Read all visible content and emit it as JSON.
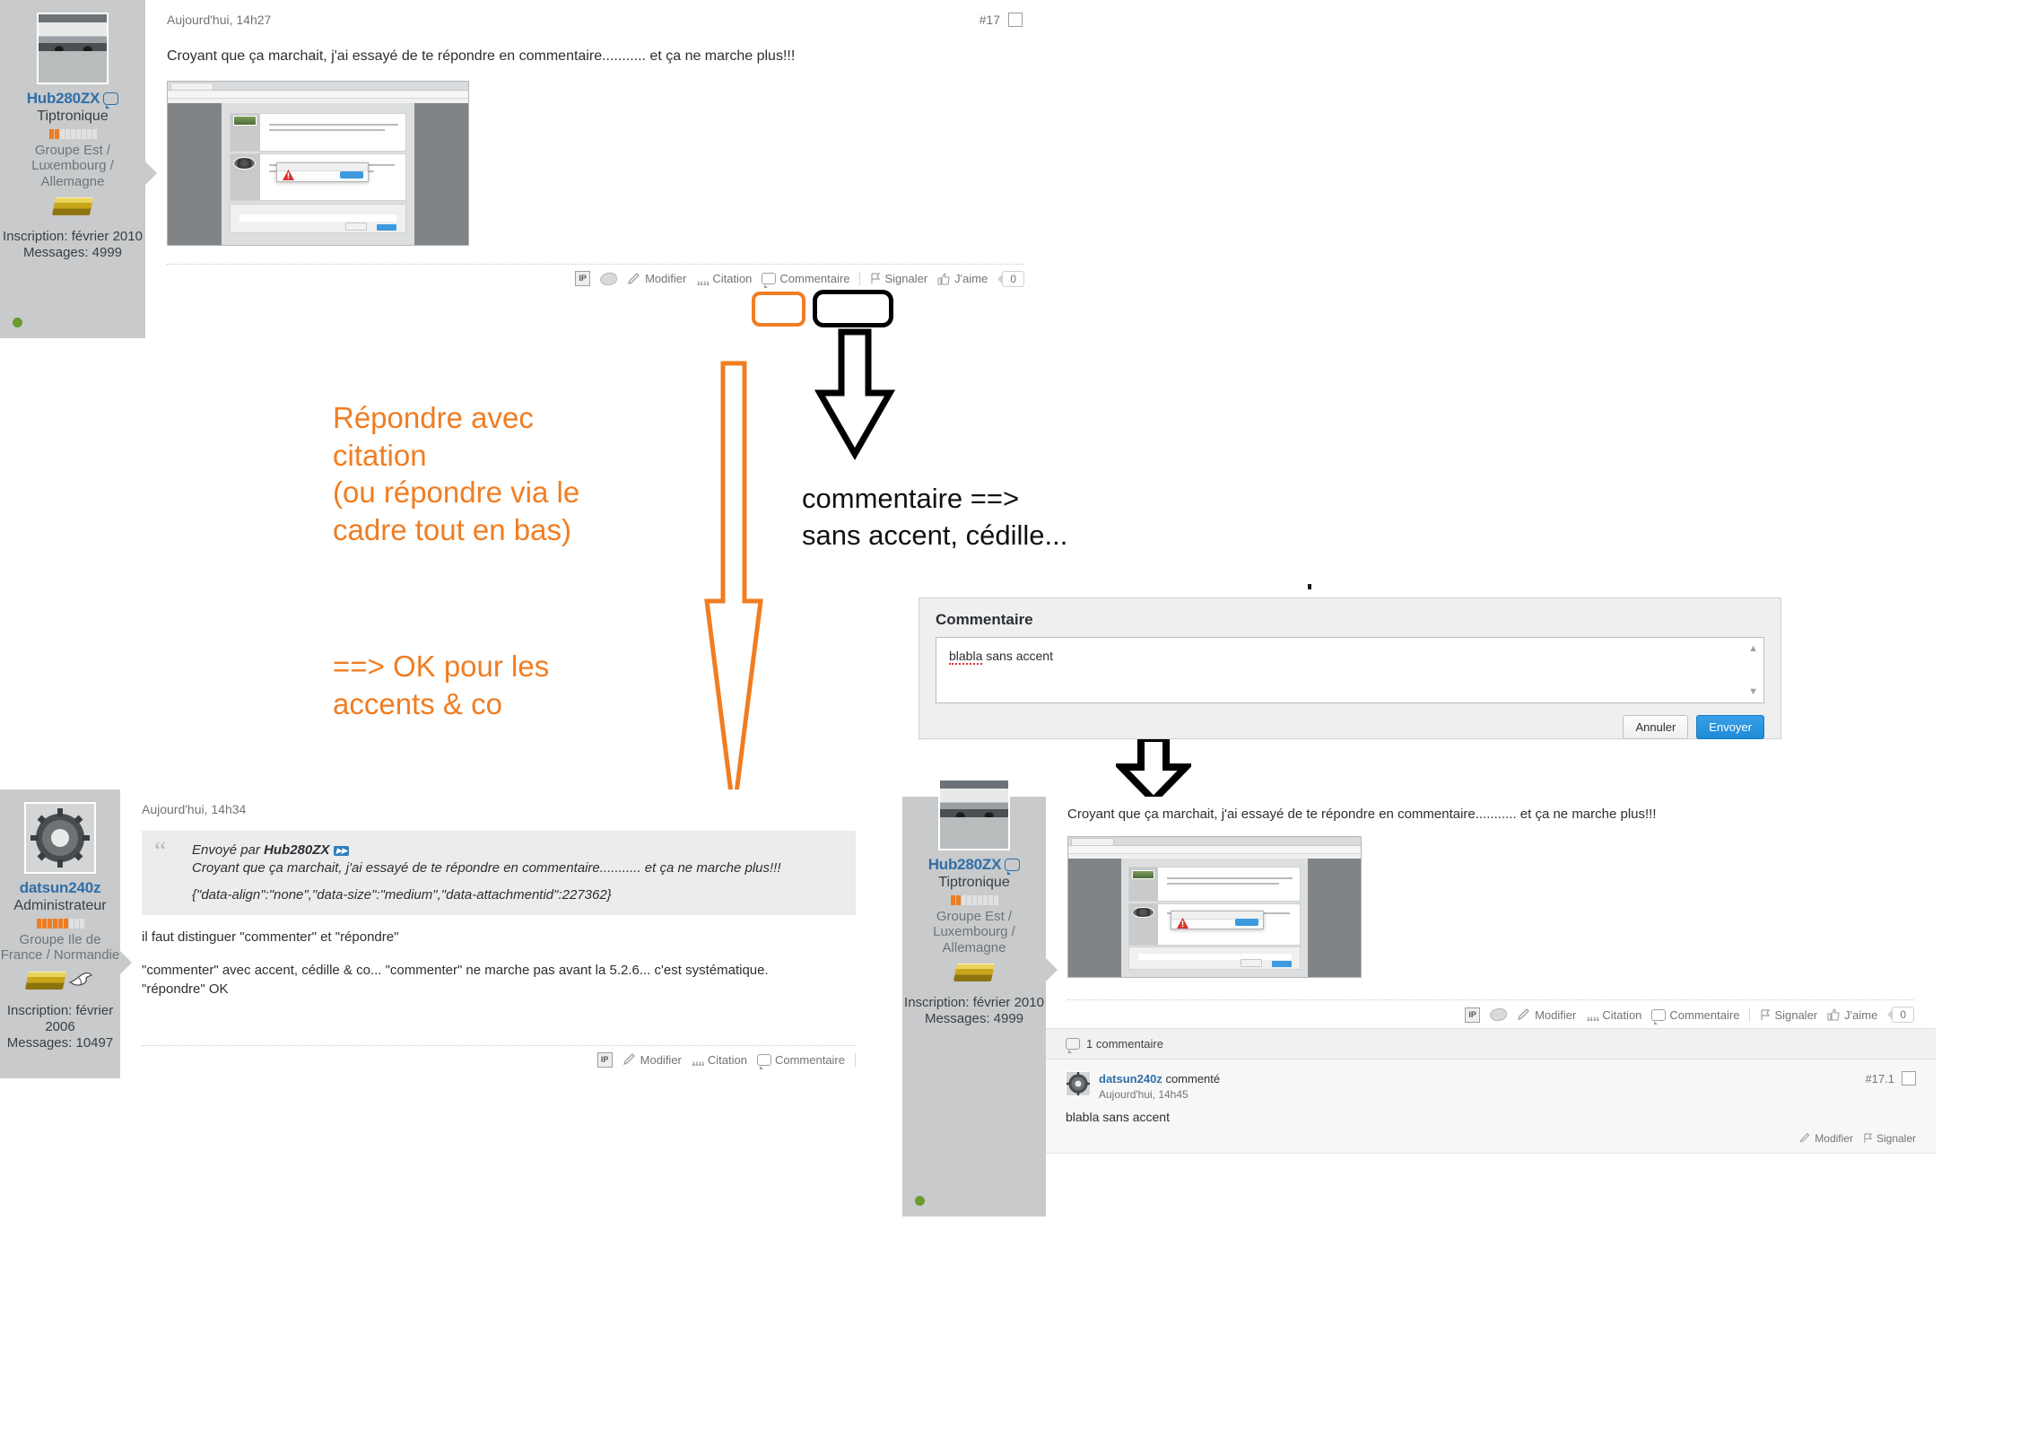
{
  "post_top": {
    "user": {
      "name": "Hub280ZX",
      "title": "Tiptronique",
      "group": "Groupe Est / Luxembourg / Allemagne",
      "inscription": "Inscription: février 2010",
      "messages": "Messages: 4999",
      "rank_filled": 2,
      "rank_total": 10
    },
    "time": "Aujourd'hui, 14h27",
    "number": "#17",
    "text": "Croyant que ça marchait, j'ai essayé de te répondre en commentaire........... et ça ne marche plus!!!",
    "footer": {
      "ip": "IP",
      "modifier": "Modifier",
      "citation": "Citation",
      "commentaire": "Commentaire",
      "signaler": "Signaler",
      "jaime": "J'aime",
      "like_count": "0"
    }
  },
  "annotations": {
    "orange_text": "Répondre avec\ncitation\n(ou répondre via le\ncadre tout en bas)",
    "orange_text2": " ==> OK pour les\n accents & co",
    "black_text": "commentaire ==>\nsans accent, cédille...",
    "orange_color": "#f07d22",
    "black_color": "#000000"
  },
  "comment_dialog": {
    "title": "Commentaire",
    "value": "blabla sans accent",
    "misspelled": "blabla",
    "rest": " sans accent",
    "cancel": "Annuler",
    "send": "Envoyer"
  },
  "post_bottom_left": {
    "user": {
      "name": "datsun240z",
      "title": "Administrateur",
      "group": "Groupe Ile de France / Normandie",
      "inscription": "Inscription: février 2006",
      "messages": "Messages: 10497",
      "rank_filled": 6,
      "rank_total": 10
    },
    "time": "Aujourd'hui, 14h34",
    "quote": {
      "header_prefix": "Envoyé par",
      "header_author": "Hub280ZX",
      "goto_icon": "▶▶",
      "line1": "Croyant que ça marchait, j'ai essayé de te répondre en commentaire........... et ça ne marche plus!!!",
      "line2": "{\"data-align\":\"none\",\"data-size\":\"medium\",\"data-attachmentid\":227362}"
    },
    "body_line1": "il faut distinguer \"commenter\" et \"répondre\"",
    "body_line2": "\"commenter\" avec accent, cédille & co... \"commenter\" ne marche pas avant la 5.2.6... c'est systématique.",
    "body_line3": "\"répondre\" OK",
    "footer": {
      "ip": "IP",
      "modifier": "Modifier",
      "citation": "Citation",
      "commentaire": "Commentaire"
    }
  },
  "post_bottom_right": {
    "user": {
      "name": "Hub280ZX",
      "title": "Tiptronique",
      "group": "Groupe Est / Luxembourg / Allemagne",
      "inscription": "Inscription: février 2010",
      "messages": "Messages: 4999",
      "rank_filled": 2,
      "rank_total": 10
    },
    "text": "Croyant que ça marchait, j'ai essayé de te répondre en commentaire........... et ça ne marche plus!!!",
    "footer": {
      "ip": "IP",
      "modifier": "Modifier",
      "citation": "Citation",
      "commentaire": "Commentaire",
      "signaler": "Signaler",
      "jaime": "J'aime",
      "like_count": "0"
    },
    "comments_bar": "1 commentaire",
    "comment": {
      "author": "datsun240z",
      "action": "commenté",
      "time": "Aujourd'hui, 14h45",
      "text": "blabla sans accent",
      "number": "#17.1",
      "modifier": "Modifier",
      "signaler": "Signaler"
    }
  }
}
